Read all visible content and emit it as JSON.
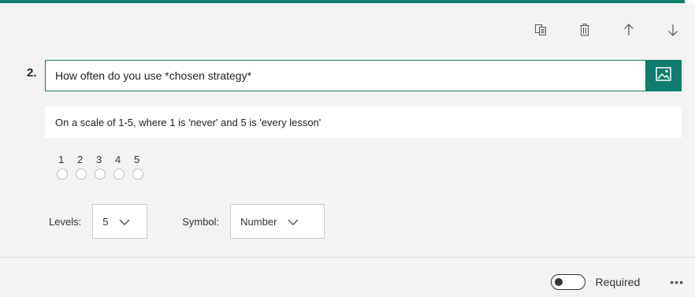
{
  "toolbar": {
    "icons": [
      "copy-icon",
      "delete-icon",
      "move-up-icon",
      "move-down-icon"
    ]
  },
  "question": {
    "number": "2.",
    "title": "How often do you use *chosen strategy*",
    "subtitle": "On a scale of 1-5, where 1 is 'never' and 5 is 'every lesson'",
    "scale_labels": [
      "1",
      "2",
      "3",
      "4",
      "5"
    ]
  },
  "controls": {
    "levels_label": "Levels:",
    "levels_value": "5",
    "symbol_label": "Symbol:",
    "symbol_value": "Number"
  },
  "footer": {
    "required_label": "Required",
    "required_on": false,
    "more_label": "•••"
  },
  "colors": {
    "accent": "#107c6b",
    "background": "#f3f3f3"
  }
}
